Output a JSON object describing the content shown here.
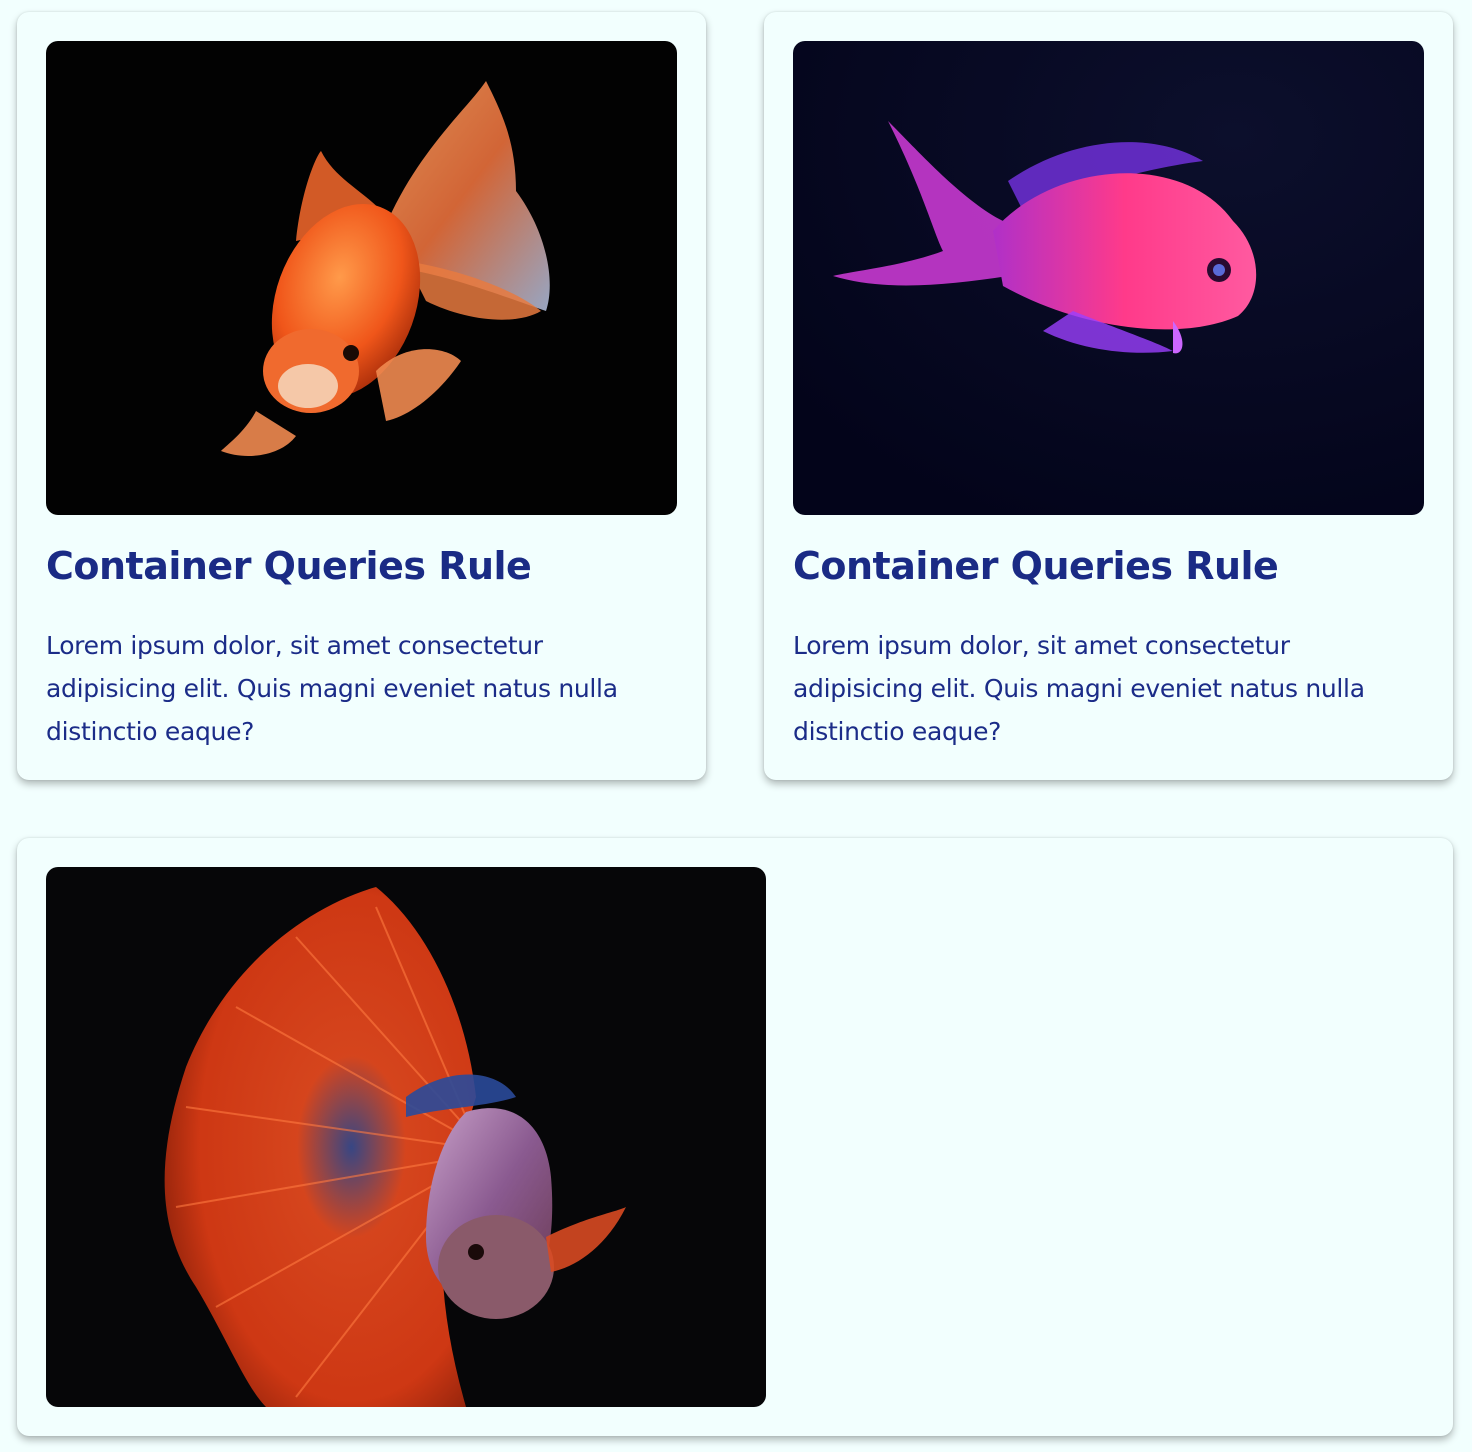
{
  "cards": [
    {
      "image_icon": "goldfish-photo",
      "title": "Container Queries Rule",
      "body": "Lorem ipsum dolor, sit amet consectetur adipisicing elit. Quis magni eveniet natus nulla distinctio eaque?"
    },
    {
      "image_icon": "anthias-fish-photo",
      "title": "Container Queries Rule",
      "body": "Lorem ipsum dolor, sit amet consectetur adipisicing elit. Quis magni eveniet natus nulla distinctio eaque?"
    },
    {
      "image_icon": "betta-fish-photo"
    }
  ],
  "colors": {
    "page_background": "#f2fffe",
    "card_background": "#f2fffe",
    "heading": "#1a2b85",
    "text": "#1b2c88"
  }
}
